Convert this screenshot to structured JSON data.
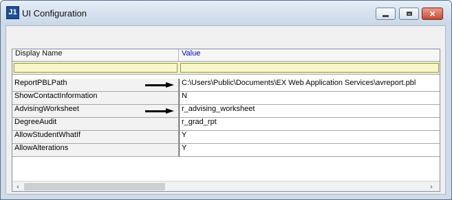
{
  "window": {
    "title": "UI Configuration",
    "app_icon_text": "J1",
    "controls": {
      "minimize": "minimize-icon",
      "maximize": "maximize-icon",
      "close": "close-icon"
    }
  },
  "grid": {
    "columns": [
      "Display Name",
      "Value"
    ],
    "filter_row": [
      "",
      ""
    ],
    "rows": [
      {
        "name": "ReportPBLPath",
        "value": "C:\\Users\\Public\\Documents\\EX Web Application Services\\avreport.pbl",
        "arrow": true
      },
      {
        "name": "ShowContactInformation",
        "value": "N",
        "arrow": false
      },
      {
        "name": "AdvisingWorksheet",
        "value": "r_advising_worksheet",
        "arrow": true
      },
      {
        "name": "DegreeAudit",
        "value": "r_grad_rpt",
        "arrow": false
      },
      {
        "name": "AllowStudentWhatIf",
        "value": "Y",
        "arrow": false
      },
      {
        "name": "AllowAlterations",
        "value": "Y",
        "arrow": false
      }
    ],
    "scroll": {
      "left": "‹",
      "right": "›"
    }
  },
  "colors": {
    "value_header": "#0000b3",
    "filter_row": "#f5f3bd",
    "close_button": "#c74a33"
  }
}
